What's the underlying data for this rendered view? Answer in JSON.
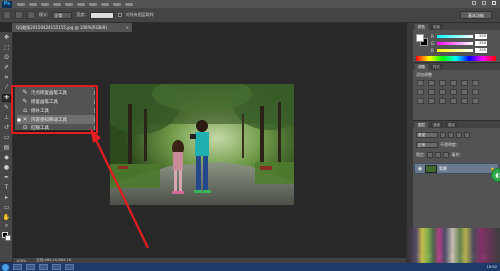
{
  "app": {
    "logo_text": "Ps"
  },
  "optbar": {
    "mode_label": "模式:",
    "mode_value": "正常",
    "width_label": "宽度:",
    "right_button": "基本功能",
    "checkbox_label": "对所有图层取样"
  },
  "document": {
    "tab_title": "QQ截图20150424155155.jpg @ 100%(RGB/8)",
    "close": "×"
  },
  "flyout": {
    "items": [
      {
        "label": "污点修复画笔工具",
        "key": "J",
        "icon": "spot-healing-brush-icon",
        "glyph": "✎"
      },
      {
        "label": "修复画笔工具",
        "key": "J",
        "icon": "healing-brush-icon",
        "glyph": "✎"
      },
      {
        "label": "修补工具",
        "key": "J",
        "icon": "patch-icon",
        "glyph": "⌂"
      },
      {
        "label": "内容感知移动工具",
        "key": "J",
        "icon": "content-aware-move-icon",
        "glyph": "✕"
      },
      {
        "label": "红眼工具",
        "key": "J",
        "icon": "red-eye-icon",
        "glyph": "⊙"
      }
    ],
    "selected_index": 3
  },
  "color_panel": {
    "tabs": [
      "颜色",
      "色板"
    ],
    "channels": [
      {
        "label": "R",
        "value": "255"
      },
      {
        "label": "G",
        "value": "255"
      },
      {
        "label": "B",
        "value": "255"
      }
    ],
    "fg": "#ffffff",
    "bg": "#000000"
  },
  "adjust_panel": {
    "tabs": [
      "调整",
      "样式"
    ],
    "title": "添加调整"
  },
  "layers_panel": {
    "tabs": [
      "图层",
      "通道",
      "路径"
    ],
    "kind_label": "类型",
    "blend_mode": "正常",
    "opacity_label": "不透明度:",
    "lock_label": "锁定:",
    "fill_label": "填充:",
    "layer_name": "背景"
  },
  "status": {
    "zoom": "100%",
    "doc_size": "文档:464.1K/464.1K"
  },
  "taskbar": {
    "clock": "15:52"
  },
  "colors": {
    "annotation_red": "#e41e1e",
    "ps_bg": "#282828"
  }
}
